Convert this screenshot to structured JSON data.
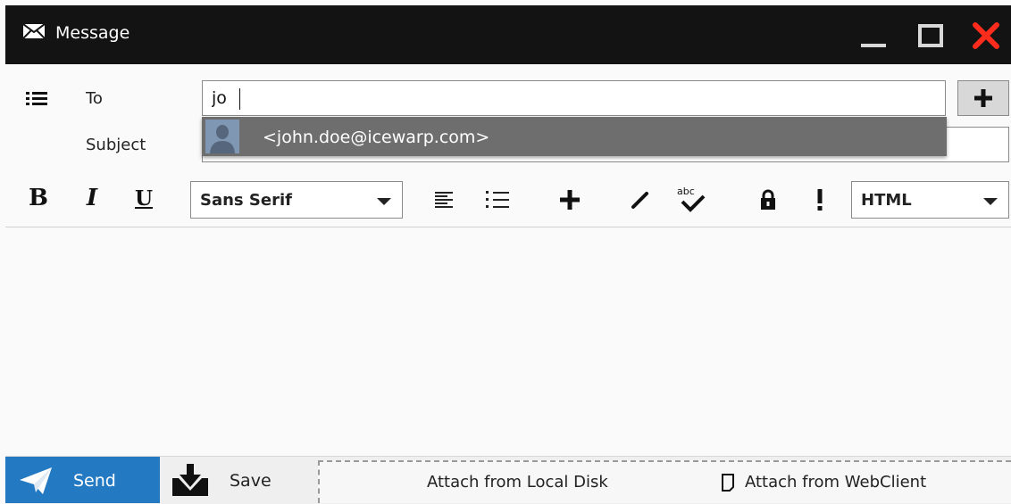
{
  "window": {
    "title": "Message",
    "title_icon": "envelope-icon",
    "close_color": "#ff2b1c"
  },
  "recipient": {
    "label": "To",
    "value": "jo",
    "list_icon": "list-icon",
    "add_icon": "plus-icon"
  },
  "suggestion": {
    "text": "<john.doe@icewarp.com>",
    "avatar_icon": "person-avatar-icon"
  },
  "subject": {
    "label": "Subject",
    "value": ""
  },
  "toolbar": {
    "bold": "B",
    "italic": "I",
    "underline": "U",
    "font": "Sans Serif",
    "format": "HTML",
    "icons": [
      "align-left-icon",
      "bullet-list-icon",
      "plus-icon",
      "pencil-icon",
      "spellcheck-icon",
      "lock-icon",
      "exclamation-icon"
    ],
    "spellcheck_text": "abc"
  },
  "footer": {
    "send_label": "Send",
    "save_label": "Save",
    "attach_local_label": "Attach from Local Disk",
    "attach_webclient_label": "Attach from WebClient",
    "accent": "#2379c2"
  }
}
